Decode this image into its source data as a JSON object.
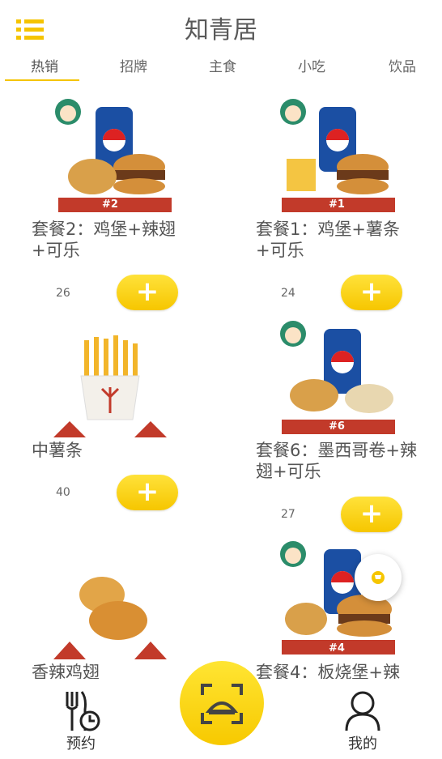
{
  "header": {
    "title": "知青居"
  },
  "tabs": [
    {
      "label": "热销"
    },
    {
      "label": "招牌"
    },
    {
      "label": "主食"
    },
    {
      "label": "小吃"
    },
    {
      "label": "饮品"
    }
  ],
  "products": [
    {
      "name": "套餐2：鸡堡+辣翅+可乐",
      "count": "26",
      "badge": "#2"
    },
    {
      "name": "套餐1：鸡堡+薯条+可乐",
      "count": "24",
      "badge": "#1"
    },
    {
      "name": "中薯条",
      "count": "40"
    },
    {
      "name": "套餐6：墨西哥卷+辣翅+可乐",
      "count": "27",
      "badge": "#6"
    },
    {
      "name": "香辣鸡翅"
    },
    {
      "name": "套餐4：板烧堡+辣",
      "badge": "#4"
    }
  ],
  "add_label": "+",
  "bottom_nav": {
    "left_label": "预约",
    "right_label": "我的"
  },
  "colors": {
    "accent": "#f6c600",
    "badge_red": "#c23a2a",
    "text": "#555555"
  },
  "icons": [
    "list-icon",
    "scan-icon",
    "cart-icon",
    "fork-clock-icon",
    "user-icon"
  ]
}
